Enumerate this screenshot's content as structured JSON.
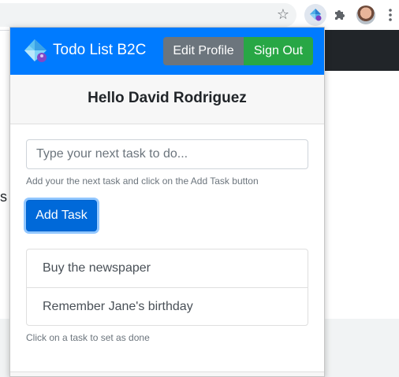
{
  "browser": {
    "bookmark_icon": "star-icon",
    "active_extension_icon": "azure-b2c-logo",
    "extensions_icon": "puzzle-icon",
    "profile_icon": "avatar",
    "menu_icon": "kebab-icon"
  },
  "page": {
    "stub_text": "s a"
  },
  "popup": {
    "navbar": {
      "brand": "Todo List B2C",
      "edit_profile_label": "Edit Profile",
      "sign_out_label": "Sign Out",
      "colors": {
        "navbar": "#007bff",
        "edit": "#6c757d",
        "signout": "#28a745"
      }
    },
    "greeting": "Hello David Rodriguez",
    "task_input": {
      "placeholder": "Type your next task to do...",
      "value": ""
    },
    "input_help": "Add your the next task and click on the Add Task button",
    "add_task_label": "Add Task",
    "tasks": [
      {
        "label": "Buy the newspaper"
      },
      {
        "label": "Remember Jane's birthday"
      }
    ],
    "list_help": "Click on a task to set as done"
  }
}
